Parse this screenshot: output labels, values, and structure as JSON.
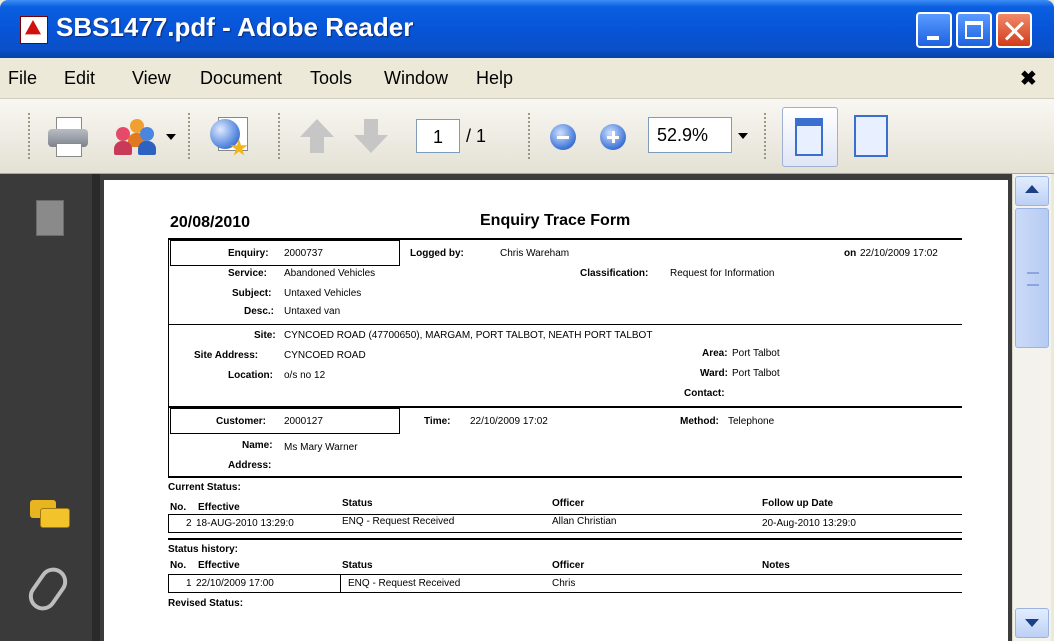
{
  "window": {
    "title": "SBS1477.pdf - Adobe Reader"
  },
  "menu": {
    "items": [
      "File",
      "Edit",
      "View",
      "Document",
      "Tools",
      "Window",
      "Help"
    ],
    "close": "✖"
  },
  "toolbar": {
    "page_current": "1",
    "page_total": "/ 1",
    "zoom": "52.9%"
  },
  "form": {
    "date": "20/08/2010",
    "title": "Enquiry Trace Form",
    "enquiry_label": "Enquiry:",
    "enquiry_value": "2000737",
    "logged_by_label": "Logged by:",
    "logged_by_value": "Chris Wareham",
    "on_label": "on",
    "on_value": "22/10/2009 17:02",
    "service_label": "Service:",
    "service_value": "Abandoned Vehicles",
    "classification_label": "Classification:",
    "classification_value": "Request for Information",
    "subject_label": "Subject:",
    "subject_value": "Untaxed Vehicles",
    "desc_label": "Desc.:",
    "desc_value": "Untaxed van",
    "site_label": "Site:",
    "site_value": "CYNCOED ROAD (47700650), MARGAM, PORT TALBOT, NEATH PORT TALBOT",
    "site_address_label": "Site Address:",
    "site_address_value": "CYNCOED ROAD",
    "area_label": "Area:",
    "area_value": "Port Talbot",
    "location_label": "Location:",
    "location_value": "o/s no 12",
    "ward_label": "Ward:",
    "ward_value": "Port Talbot",
    "contact_label": "Contact:",
    "customer_label": "Customer:",
    "customer_value": "2000127",
    "time_label": "Time:",
    "time_value": "22/10/2009 17:02",
    "method_label": "Method:",
    "method_value": "Telephone",
    "name_label": "Name:",
    "name_value": "Ms Mary Warner",
    "address_label": "Address:",
    "current_status_label": "Current Status:",
    "current_headers": [
      "No.",
      "Effective",
      "Status",
      "Officer",
      "Follow up Date"
    ],
    "current_row": [
      "2",
      "18-AUG-2010 13:29:0",
      "ENQ - Request Received",
      "Allan Christian",
      "20-Aug-2010 13:29:0"
    ],
    "history_label": "Status history:",
    "history_headers": [
      "No.",
      "Effective",
      "Status",
      "Officer",
      "Notes"
    ],
    "history_row": [
      "1",
      "22/10/2009 17:00",
      "ENQ - Request Received",
      "Chris"
    ],
    "revised_label": "Revised Status:"
  }
}
